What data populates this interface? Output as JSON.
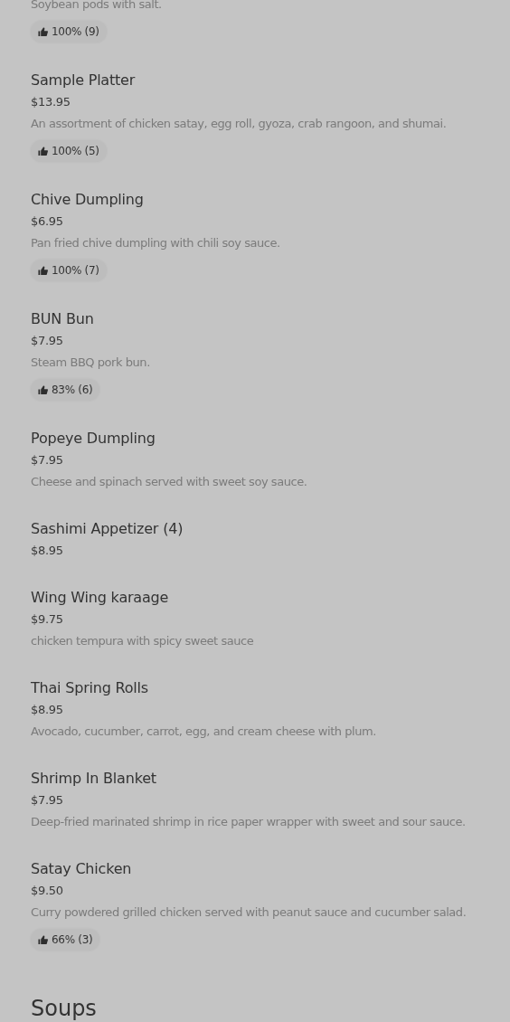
{
  "items": [
    {
      "description": "Soybean pods with salt.",
      "rating": "100% (9)"
    },
    {
      "name": "Sample Platter",
      "price": "$13.95",
      "description": "An assortment of chicken satay, egg roll, gyoza, crab rangoon, and shumai.",
      "rating": "100% (5)"
    },
    {
      "name": "Chive Dumpling",
      "price": "$6.95",
      "description": "Pan fried chive dumpling with chili soy sauce.",
      "rating": "100% (7)"
    },
    {
      "name": "BUN Bun",
      "price": "$7.95",
      "description": "Steam BBQ pork bun.",
      "rating": "83% (6)"
    },
    {
      "name": "Popeye Dumpling",
      "price": "$7.95",
      "description": "Cheese and spinach served with sweet soy sauce."
    },
    {
      "name": "Sashimi Appetizer (4)",
      "price": "$8.95"
    },
    {
      "name": "Wing Wing karaage",
      "price": "$9.75",
      "description": "chicken tempura with spicy sweet sauce"
    },
    {
      "name": "Thai Spring Rolls",
      "price": "$8.95",
      "description": "Avocado, cucumber, carrot, egg, and cream cheese with plum."
    },
    {
      "name": "Shrimp In Blanket",
      "price": "$7.95",
      "description": "Deep-fried marinated shrimp in rice paper wrapper with sweet and sour sauce."
    },
    {
      "name": "Satay Chicken",
      "price": "$9.50",
      "description": "Curry powdered grilled chicken served with peanut sauce and cucumber salad.",
      "rating": "66% (3)"
    }
  ],
  "next_section": {
    "title": "Soups"
  }
}
